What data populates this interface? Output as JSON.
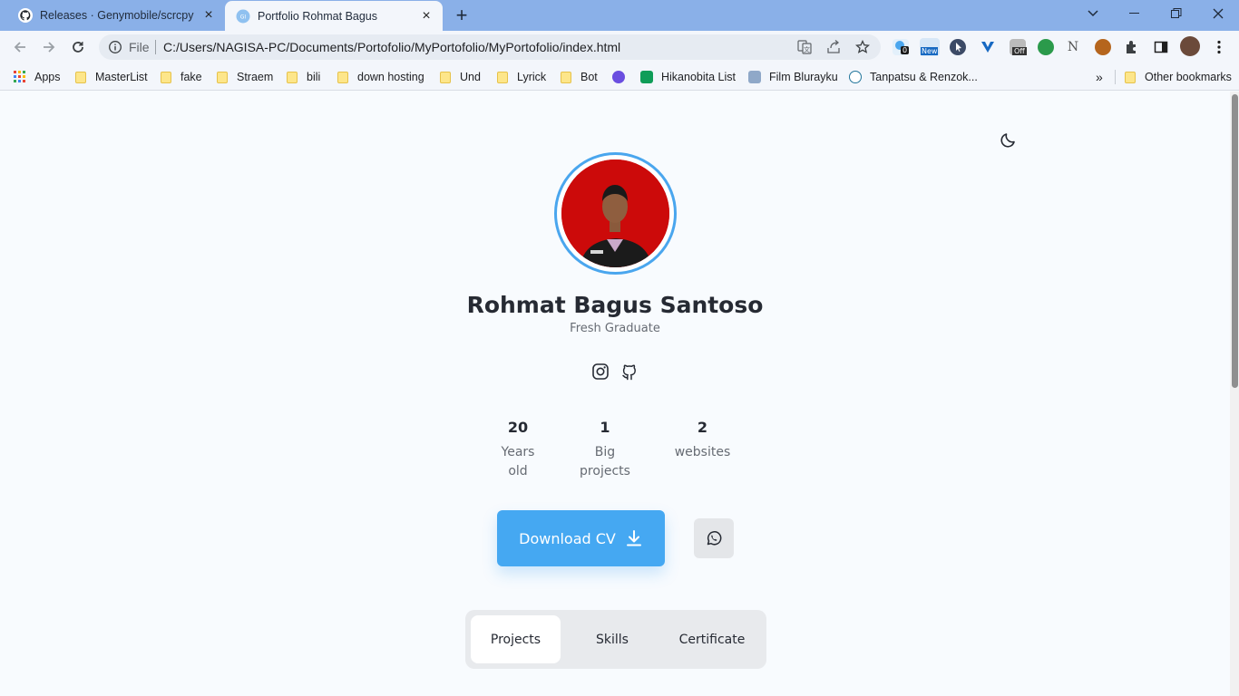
{
  "browser": {
    "tabs": [
      {
        "title": "Releases · Genymobile/scrcpy",
        "icon": "github-icon"
      },
      {
        "title": "Portfolio Rohmat Bagus",
        "icon": "site-icon"
      }
    ],
    "address": {
      "scheme": "File",
      "url": "C:/Users/NAGISA-PC/Documents/Portofolio/MyPortofolio/MyPortofolio/index.html"
    },
    "extensions": {
      "badge_count": "0",
      "badge_new": "New",
      "badge_off": "Off"
    },
    "bookmarks": [
      {
        "label": "Apps"
      },
      {
        "label": "MasterList"
      },
      {
        "label": "fake"
      },
      {
        "label": "Straem"
      },
      {
        "label": "bili"
      },
      {
        "label": "down hosting"
      },
      {
        "label": "Und"
      },
      {
        "label": "Lyrick"
      },
      {
        "label": "Bot"
      },
      {
        "label": "Hikanobita List"
      },
      {
        "label": "Film Blurayku"
      },
      {
        "label": "Tanpatsu & Renzok..."
      },
      {
        "label": "Other bookmarks"
      }
    ]
  },
  "profile": {
    "name": "Rohmat Bagus Santoso",
    "role": "Fresh Graduate",
    "stats": [
      {
        "value": "20",
        "label": "Years old"
      },
      {
        "value": "1",
        "label": "Big projects"
      },
      {
        "value": "2",
        "label": "websites"
      }
    ],
    "download_label": "Download CV"
  },
  "sections": {
    "tabs": [
      {
        "label": "Projects",
        "active": true
      },
      {
        "label": "Skills",
        "active": false
      },
      {
        "label": "Certificate",
        "active": false
      }
    ]
  },
  "colors": {
    "accent": "#45a8f2",
    "tabbar": "#8ab0e8",
    "avatar_bg": "#cc0a0a"
  }
}
